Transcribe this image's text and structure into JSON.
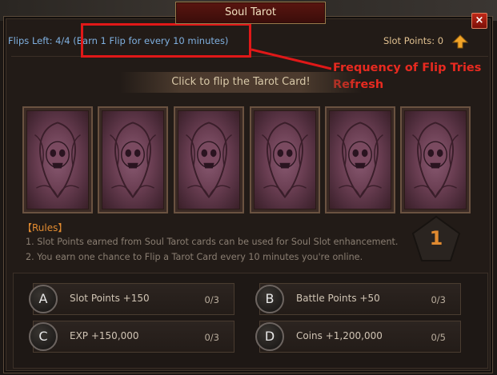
{
  "window": {
    "title": "Soul Tarot",
    "close_label": "×"
  },
  "header": {
    "flips_label": "Flips Left: 4/4",
    "flips_note": "(Earn 1 Flip for every 10 minutes)",
    "slot_points_label": "Slot Points: 0",
    "upgrade_icon": "arrow-up-icon"
  },
  "annotation": {
    "line1": "Frequency of Flip Tries",
    "line2": "Refresh"
  },
  "prompt": "Click to flip the Tarot Card!",
  "cards": [
    {
      "name": "tarot-card-1"
    },
    {
      "name": "tarot-card-2"
    },
    {
      "name": "tarot-card-3"
    },
    {
      "name": "tarot-card-4"
    },
    {
      "name": "tarot-card-5"
    },
    {
      "name": "tarot-card-6"
    }
  ],
  "rules": {
    "title": "【Rules】",
    "items": [
      "1. Slot Points earned from Soul Tarot cards can be used for Soul Slot enhancement.",
      "2. You earn one chance to Flip a Tarot Card every 10 minutes you're online."
    ]
  },
  "counter": "1",
  "rewards": [
    {
      "badge": "A",
      "label": "Slot Points +150",
      "count": "0/3"
    },
    {
      "badge": "B",
      "label": "Battle Points +50",
      "count": "0/3"
    },
    {
      "badge": "C",
      "label": "EXP +150,000",
      "count": "0/3"
    },
    {
      "badge": "D",
      "label": "Coins +1,200,000",
      "count": "0/5"
    }
  ],
  "colors": {
    "accent_orange": "#e08a30",
    "annotation_red": "#e01818",
    "flips_blue": "#7fb0e0"
  }
}
